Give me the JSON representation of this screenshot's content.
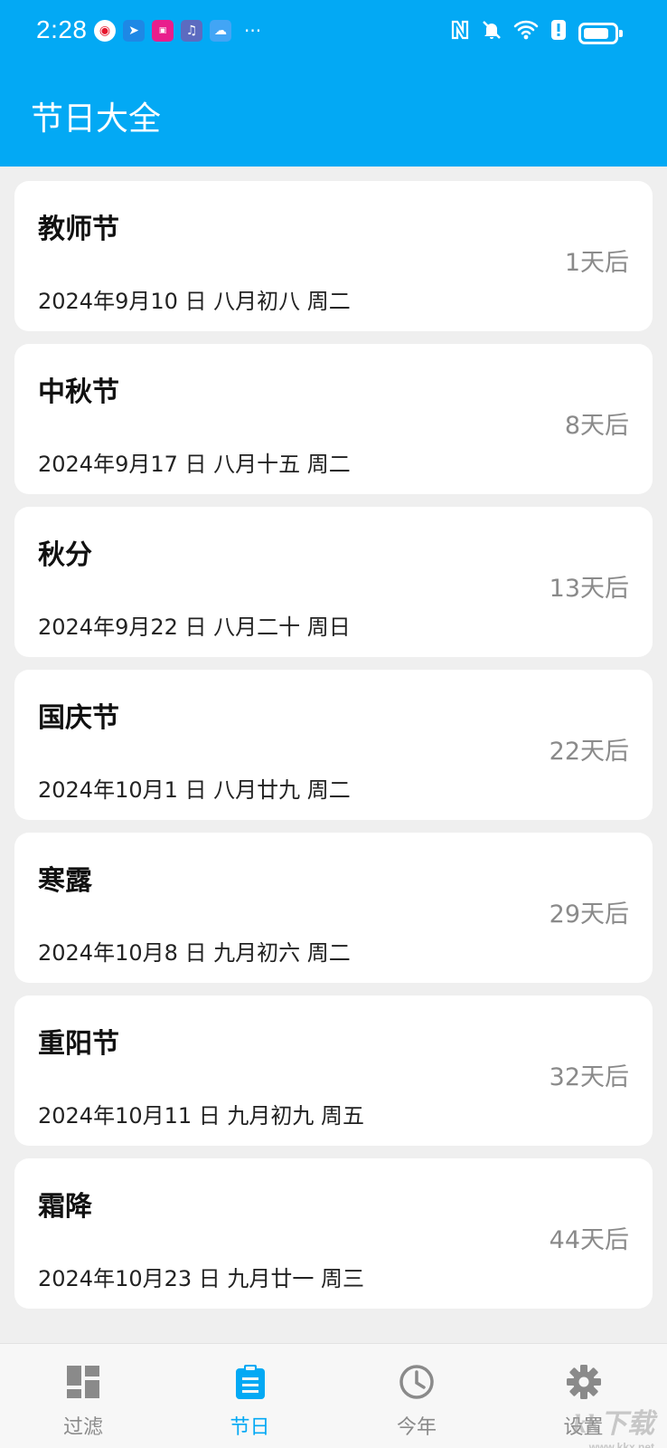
{
  "status_bar": {
    "time": "2:28",
    "left_icons": [
      "weibo-icon",
      "bolt-app-icon",
      "tv-app-icon",
      "music-app-icon",
      "weather-cloud-icon"
    ],
    "more": "···",
    "right_icons": [
      "nfc-icon",
      "bell-muted-icon",
      "wifi-icon",
      "alert-icon",
      "battery-icon"
    ],
    "battery_level": 0.85
  },
  "app_bar": {
    "title": "节日大全"
  },
  "festivals": [
    {
      "name": "教师节",
      "date": "2024年9月10 日  八月初八 周二",
      "countdown": "1天后"
    },
    {
      "name": "中秋节",
      "date": "2024年9月17 日  八月十五 周二",
      "countdown": "8天后"
    },
    {
      "name": "秋分",
      "date": "2024年9月22 日  八月二十 周日",
      "countdown": "13天后"
    },
    {
      "name": "国庆节",
      "date": "2024年10月1 日  八月廿九 周二",
      "countdown": "22天后"
    },
    {
      "name": "寒露",
      "date": "2024年10月8 日  九月初六 周二",
      "countdown": "29天后"
    },
    {
      "name": "重阳节",
      "date": "2024年10月11 日  九月初九 周五",
      "countdown": "32天后"
    },
    {
      "name": "霜降",
      "date": "2024年10月23 日  九月廿一 周三",
      "countdown": "44天后"
    }
  ],
  "bottom_nav": [
    {
      "label": "过滤",
      "icon": "dashboard-icon",
      "active": false
    },
    {
      "label": "节日",
      "icon": "clipboard-list-icon",
      "active": true
    },
    {
      "label": "今年",
      "icon": "clock-icon",
      "active": false
    },
    {
      "label": "设置",
      "icon": "gear-icon",
      "active": false
    }
  ],
  "colors": {
    "primary": "#03a9f4",
    "inactive": "#8a8a8a",
    "background": "#efefef"
  },
  "watermark": {
    "text": "kk下载",
    "sub": "www.kkx.net"
  }
}
